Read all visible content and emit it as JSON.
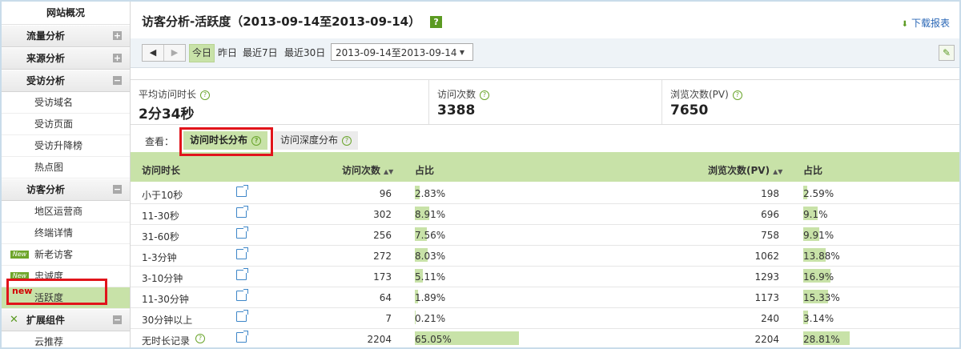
{
  "sidebar": {
    "top": "网站概况",
    "sections": [
      {
        "label": "流量分析",
        "toggle": "+"
      },
      {
        "label": "来源分析",
        "toggle": "+"
      },
      {
        "label": "受访分析",
        "toggle": "−"
      }
    ],
    "visit_items": [
      "受访域名",
      "受访页面",
      "受访升降榜",
      "热点图"
    ],
    "visitor_section": {
      "label": "访客分析",
      "toggle": "−"
    },
    "visitor_items": [
      {
        "label": "地区运营商",
        "tag": ""
      },
      {
        "label": "终端详情",
        "tag": ""
      },
      {
        "label": "新老访客",
        "tag": "New"
      },
      {
        "label": "忠诚度",
        "tag": "New"
      },
      {
        "label": "活跃度",
        "tag": "new"
      }
    ],
    "ext_section": {
      "label": "扩展组件",
      "toggle": "−"
    },
    "ext_items": [
      "云推荐"
    ]
  },
  "header": {
    "title": "访客分析-活跃度（2013-09-14至2013-09-14）",
    "help": "?",
    "download": "下载报表"
  },
  "toolbar": {
    "ranges": [
      "今日",
      "昨日",
      "最近7日",
      "最近30日"
    ],
    "date_range": "2013-09-14至2013-09-14"
  },
  "kpis": [
    {
      "label": "平均访问时长",
      "value": "2分34秒"
    },
    {
      "label": "访问次数",
      "value": "3388"
    },
    {
      "label": "浏览次数(PV)",
      "value": "7650"
    }
  ],
  "view": {
    "label": "查看：",
    "tabs": [
      "访问时长分布",
      "访问深度分布"
    ]
  },
  "table": {
    "headers": [
      "访问时长",
      "访问次数",
      "占比",
      "浏览次数(PV)",
      "占比"
    ],
    "rows": [
      {
        "label": "小于10秒",
        "visits": "96",
        "visit_pct": "2.83%",
        "visit_frac": 0.0283,
        "pv": "198",
        "pv_pct": "2.59%",
        "pv_frac": 0.0259
      },
      {
        "label": "11-30秒",
        "visits": "302",
        "visit_pct": "8.91%",
        "visit_frac": 0.0891,
        "pv": "696",
        "pv_pct": "9.1%",
        "pv_frac": 0.091
      },
      {
        "label": "31-60秒",
        "visits": "256",
        "visit_pct": "7.56%",
        "visit_frac": 0.0756,
        "pv": "758",
        "pv_pct": "9.91%",
        "pv_frac": 0.0991
      },
      {
        "label": "1-3分钟",
        "visits": "272",
        "visit_pct": "8.03%",
        "visit_frac": 0.0803,
        "pv": "1062",
        "pv_pct": "13.88%",
        "pv_frac": 0.1388
      },
      {
        "label": "3-10分钟",
        "visits": "173",
        "visit_pct": "5.11%",
        "visit_frac": 0.0511,
        "pv": "1293",
        "pv_pct": "16.9%",
        "pv_frac": 0.169
      },
      {
        "label": "11-30分钟",
        "visits": "64",
        "visit_pct": "1.89%",
        "visit_frac": 0.0189,
        "pv": "1173",
        "pv_pct": "15.33%",
        "pv_frac": 0.1533
      },
      {
        "label": "30分钟以上",
        "visits": "7",
        "visit_pct": "0.21%",
        "visit_frac": 0.0021,
        "pv": "240",
        "pv_pct": "3.14%",
        "pv_frac": 0.0314
      },
      {
        "label": "无时长记录",
        "visits": "2204",
        "visit_pct": "65.05%",
        "visit_frac": 0.6505,
        "pv": "2204",
        "pv_pct": "28.81%",
        "pv_frac": 0.2881
      }
    ]
  },
  "colors": {
    "accent": "#c8e2a8",
    "brand_green": "#5b9a22",
    "highlight_red": "#e1141b",
    "link_blue": "#2a67b6"
  }
}
